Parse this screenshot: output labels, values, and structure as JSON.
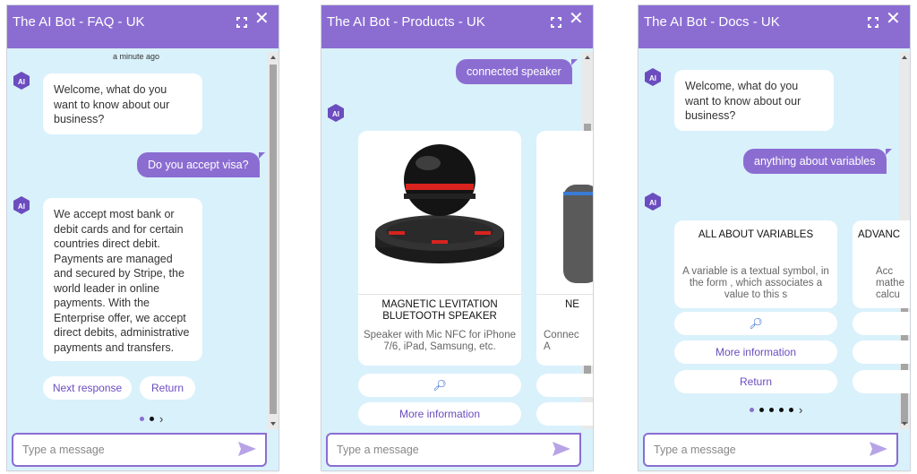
{
  "widgets": [
    {
      "title": "The AI Bot - FAQ - UK",
      "timestamp": "a minute ago",
      "welcome": "Welcome, what do you want to know about our business?",
      "user_message": "Do you accept visa?",
      "answer": "We accept most bank or debit cards and for certain countries direct debit. Payments are managed and secured by Stripe, the world leader in online payments. With the Enterprise offer, we accept direct debits, administrative payments and transfers.",
      "buttons": [
        "Next response",
        "Return"
      ],
      "input_placeholder": "Type a message"
    },
    {
      "title": "The AI Bot - Products - UK",
      "user_message": "connected speaker",
      "cards": [
        {
          "title": "MAGNETIC LEVITATION BLUETOOTH SPEAKER",
          "subtitle": "Speaker with Mic NFC for iPhone 7/6, iPad, Samsung, etc."
        },
        {
          "title": "NE",
          "subtitle": "Connec A"
        }
      ],
      "buttons": [
        "More information"
      ],
      "input_placeholder": "Type a message"
    },
    {
      "title": "The AI Bot - Docs - UK",
      "welcome": "Welcome, what do you want to know about our business?",
      "user_message": "anything about variables",
      "cards": [
        {
          "title": "ALL ABOUT VARIABLES",
          "subtitle": "A variable is a textual symbol, in the form , which associates a value to this s"
        },
        {
          "title": "ADVANC",
          "subtitle": "Acc mathe calcu"
        }
      ],
      "buttons": [
        "More information",
        "Return"
      ],
      "input_placeholder": "Type a message"
    }
  ],
  "colors": {
    "header": "#8b6dd2",
    "background": "#d9f1fb",
    "accent_text": "#6b4dbf"
  },
  "icons": [
    "expand-icon",
    "close-icon",
    "bot-avatar-icon",
    "search-icon",
    "send-icon",
    "chevron-right-icon"
  ]
}
